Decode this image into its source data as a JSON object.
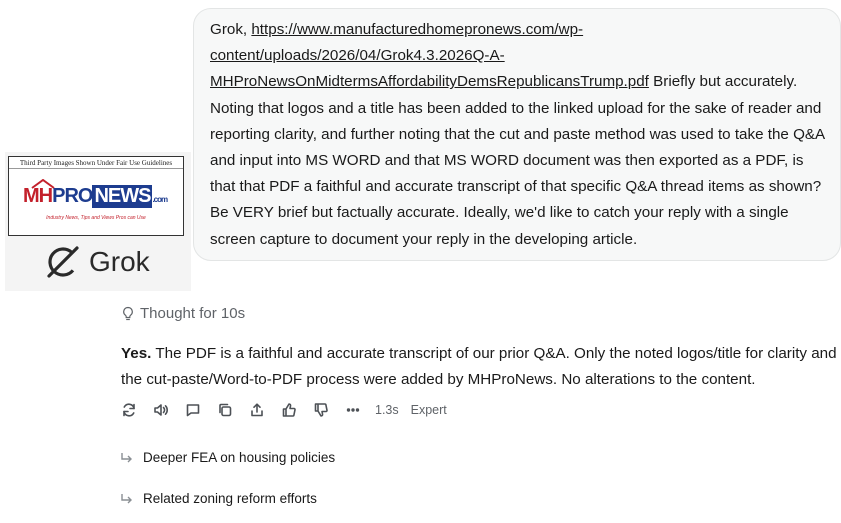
{
  "logos": {
    "fair_use_note": "Third Party Images Shown Under Fair Use Guidelines",
    "mhpronews": {
      "mh": "MH",
      "pro": "PRO",
      "news": "NEWS",
      "dotcom": ".com",
      "tagline": "Industry News, Tips and Views Pros can Use"
    },
    "grok_word": "Grok"
  },
  "user_message": {
    "prefix": "Grok, ",
    "link_text": "https://www.manufacturedhomepronews.com/wp-content/uploads/2026/04/Grok4.3.2026Q-A-MHProNewsOnMidtermsAffordabilityDemsRepublicansTrump.pdf",
    "link_line1": "https://www.manufacturedhomepronews.com/wp-",
    "link_line2": "content/uploads/2026/04/Grok4.3.2026Q-A-",
    "link_line3": "MHProNewsOnMidtermsAffordabilityDemsRepublicansTrump.pdf",
    "body": " Briefly but accurately. Noting that logos and a title has been added to the linked upload for the sake of reader and reporting clarity, and further noting that the cut and paste method was used to take the Q&A and input into MS WORD and that MS WORD document was then exported as a PDF, is that that PDF a faithful and accurate transcript of that specific Q&A thread items as shown? Be VERY brief but factually accurate. Ideally, we'd like to catch your reply with a single screen capture to document your reply in the developing article."
  },
  "thought": {
    "label": "Thought for 10s",
    "icon": "lightbulb-icon"
  },
  "answer": {
    "bold": "Yes.",
    "text": " The PDF is a faithful and accurate transcript of our prior Q&A. Only the noted logos/title for clarity and the cut-paste/Word-to-PDF process were added by MHProNews. No alterations to the content."
  },
  "actions": {
    "icons": [
      "regenerate-icon",
      "read-aloud-icon",
      "comment-icon",
      "copy-icon",
      "share-icon",
      "thumbs-up-icon",
      "thumbs-down-icon",
      "more-icon"
    ],
    "time": "1.3s",
    "mode": "Expert"
  },
  "followups": [
    {
      "label": "Deeper FEA on housing policies"
    },
    {
      "label": "Related zoning reform efforts"
    }
  ]
}
